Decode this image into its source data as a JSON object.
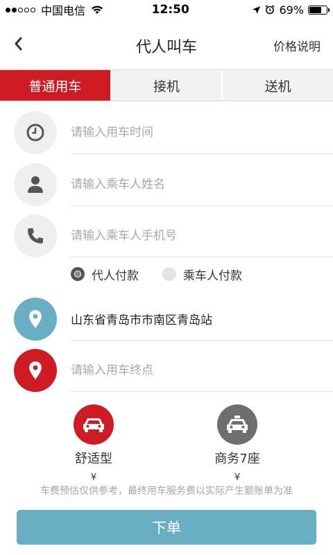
{
  "status_bar": {
    "carrier": "中国电信",
    "time": "12:50",
    "battery": "69%",
    "battery_level": 0.69
  },
  "nav": {
    "title": "代人叫车",
    "price_link": "价格说明"
  },
  "tabs": [
    {
      "label": "普通用车",
      "active": true
    },
    {
      "label": "接机",
      "active": false
    },
    {
      "label": "送机",
      "active": false
    }
  ],
  "form": {
    "time_placeholder": "请输入用车时间",
    "name_placeholder": "请输入乘车人姓名",
    "phone_placeholder": "请输入乘车人手机号",
    "start_location": "山东省青岛市市南区青岛站",
    "destination_placeholder": "请输入用车终点"
  },
  "payment": {
    "options": [
      {
        "label": "代人付款",
        "checked": true
      },
      {
        "label": "乘车人付款",
        "checked": false
      }
    ]
  },
  "car_types": [
    {
      "label": "舒适型",
      "price": "¥"
    },
    {
      "label": "商务7座",
      "price": "¥"
    }
  ],
  "note": "车费预估仅供参考，最终用车服务费以实际产生额账单为准",
  "submit_label": "下单",
  "colors": {
    "accent_red": "#cf1c24",
    "accent_blue": "#6aaec4"
  }
}
